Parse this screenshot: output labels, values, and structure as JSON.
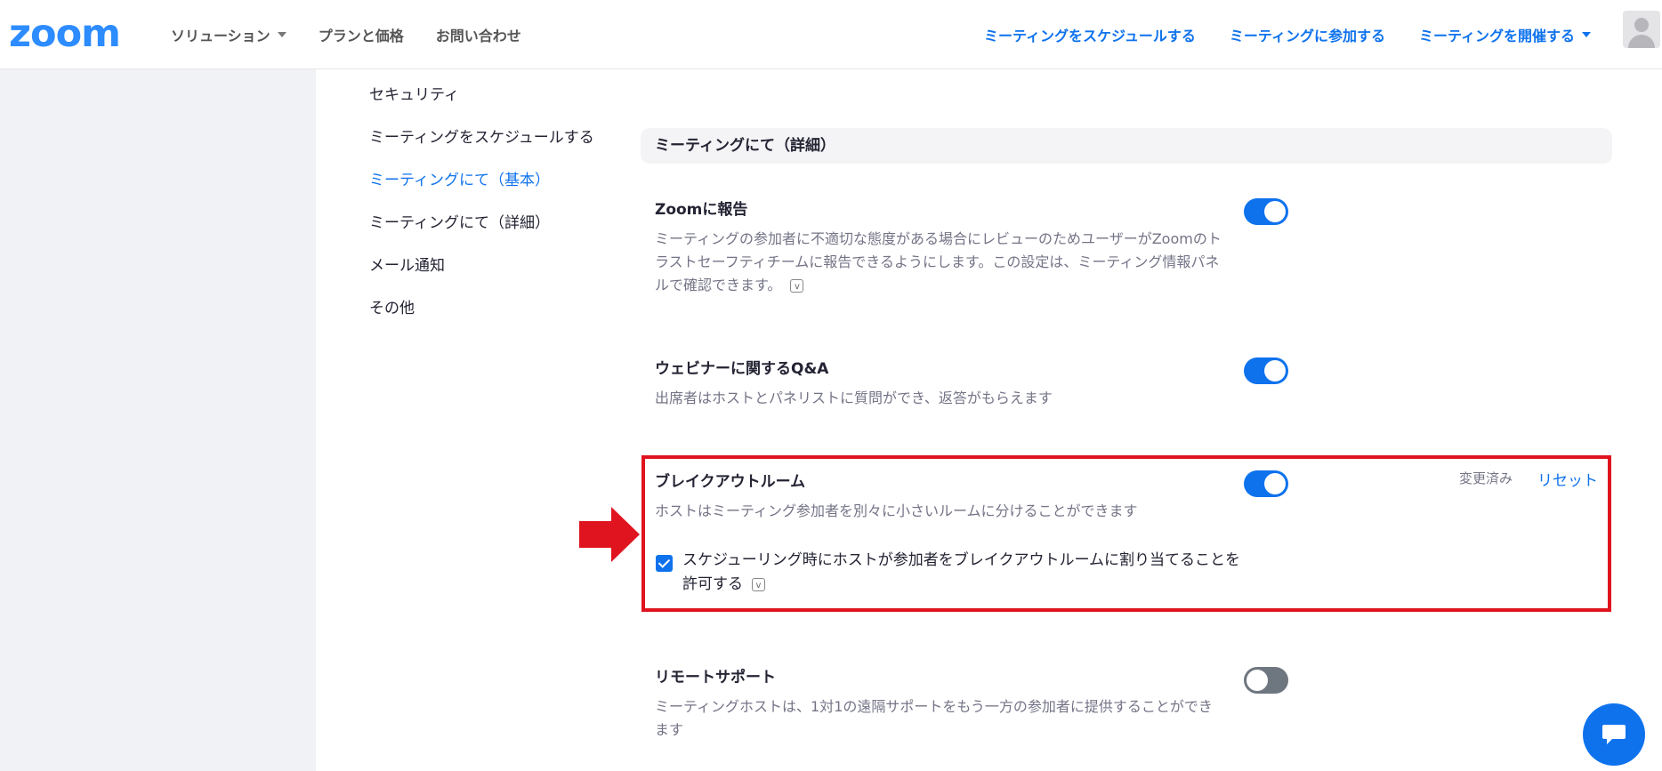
{
  "header": {
    "logo": "zoom",
    "nav_left": [
      "ソリューション",
      "プランと価格",
      "お問い合わせ"
    ],
    "nav_right": [
      "ミーティングをスケジュールする",
      "ミーティングに参加する",
      "ミーティングを開催する"
    ],
    "accent_color": "#0e72ed"
  },
  "sidebar": {
    "items": [
      {
        "label": "セキュリティ",
        "active": false
      },
      {
        "label": "ミーティングをスケジュールする",
        "active": false
      },
      {
        "label": "ミーティングにて（基本）",
        "active": true
      },
      {
        "label": "ミーティングにて（詳細）",
        "active": false
      },
      {
        "label": "メール通知",
        "active": false
      },
      {
        "label": "その他",
        "active": false
      }
    ]
  },
  "section": {
    "title": "ミーティングにて（詳細）"
  },
  "settings": [
    {
      "title": "Zoomに報告",
      "desc": "ミーティングの参加者に不適切な態度がある場合にレビューのためユーザーがZoomのトラストセーフティチームに報告できるようにします。この設定は、ミーティング情報パネルで確認できます。",
      "enabled": true
    },
    {
      "title": "ウェビナーに関するQ&A",
      "desc": "出席者はホストとパネリストに質問ができ、返答がもらえます",
      "enabled": true
    },
    {
      "title": "ブレイクアウトルーム",
      "desc": "ホストはミーティング参加者を別々に小さいルームに分けることができます",
      "enabled": true,
      "status": "変更済み",
      "reset_label": "リセット",
      "option": {
        "label": "スケジューリング時にホストが参加者をブレイクアウトルームに割り当てることを許可する",
        "checked": true
      }
    },
    {
      "title": "リモートサポート",
      "desc": "ミーティングホストは、1対1の遠隔サポートをもう一方の参加者に提供することができます",
      "enabled": false
    }
  ],
  "annotation": {
    "highlight_color": "#e0141e"
  }
}
